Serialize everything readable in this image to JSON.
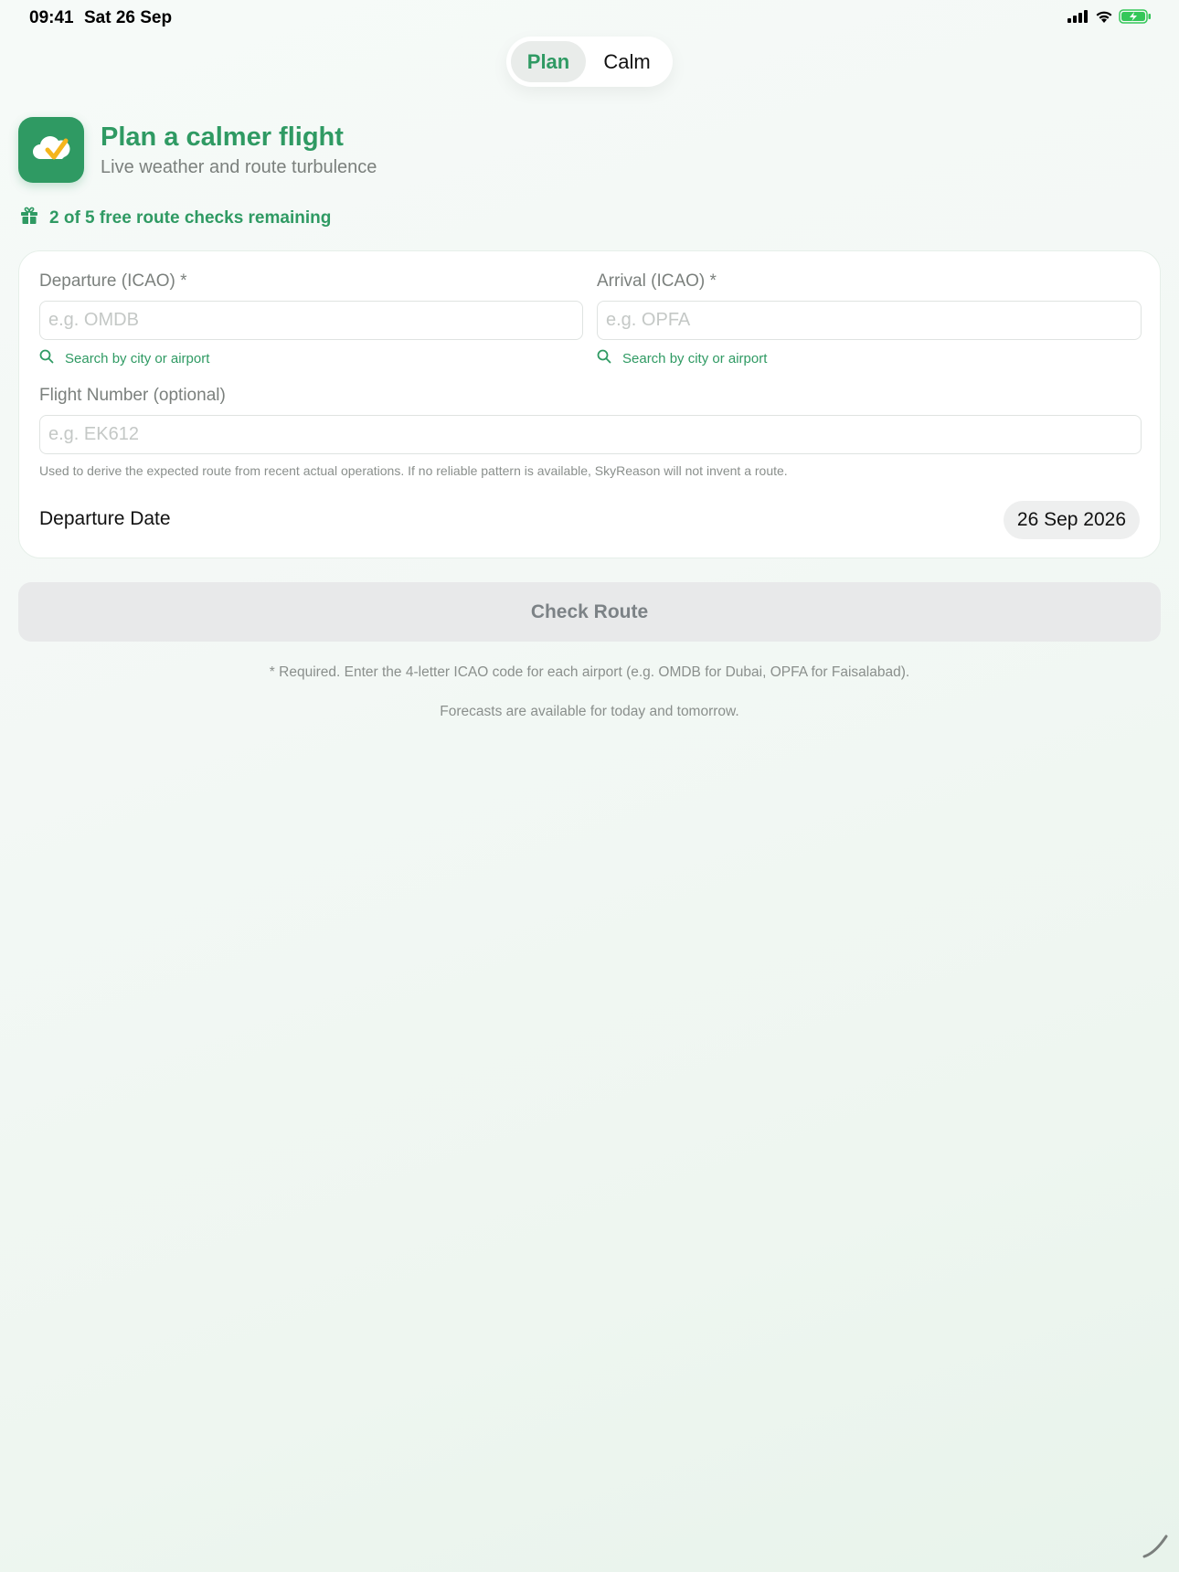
{
  "status_bar": {
    "time": "09:41",
    "date": "Sat 26 Sep",
    "icons": [
      "cellular-signal-icon",
      "wifi-icon",
      "battery-charging-icon"
    ]
  },
  "segmented": {
    "items": [
      {
        "label": "Plan",
        "selected": true
      },
      {
        "label": "Calm",
        "selected": false
      }
    ]
  },
  "header": {
    "app_icon": "cloud-check-icon",
    "title": "Plan a calmer flight",
    "subtitle": "Live weather and route turbulence",
    "free_checks": "2 of 5 free route checks remaining",
    "free_checks_icon": "gift-icon"
  },
  "form": {
    "departure": {
      "label": "Departure (ICAO) *",
      "value": "",
      "placeholder": "e.g. OMDB",
      "search_link": "Search by city or airport"
    },
    "arrival": {
      "label": "Arrival (ICAO) *",
      "value": "",
      "placeholder": "e.g. OPFA",
      "search_link": "Search by city or airport"
    },
    "flight_number": {
      "label": "Flight Number (optional)",
      "value": "",
      "placeholder": "e.g. EK612",
      "help": "Used to derive the expected route from recent actual operations. If no reliable pattern is available, SkyReason will not invent a route."
    },
    "departure_date": {
      "label": "Departure Date",
      "value": "26 Sep 2026"
    }
  },
  "actions": {
    "check_route": "Check Route"
  },
  "footnotes": {
    "required": "* Required. Enter the 4-letter ICAO code for each airport (e.g. OMDB for Dubai, OPFA for Faisalabad).",
    "forecast": "Forecasts are available for today and tomorrow."
  },
  "colors": {
    "accent": "#2f9a63",
    "accent_secondary": "#f5b51c",
    "button_disabled_bg": "#e8e9ea",
    "muted_text": "#7b807d"
  }
}
